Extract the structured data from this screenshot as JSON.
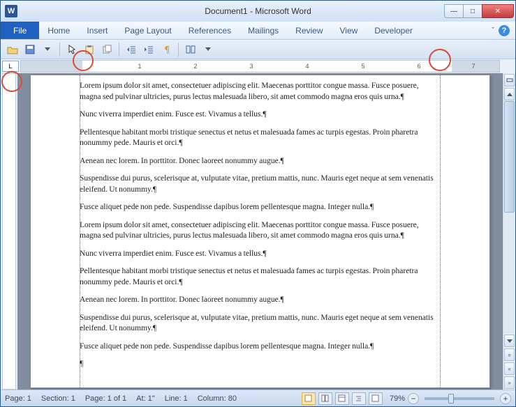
{
  "title": "Document1  -  Microsoft Word",
  "word_glyph": "W",
  "menu": {
    "file": "File",
    "items": [
      "Home",
      "Insert",
      "Page Layout",
      "References",
      "Mailings",
      "Review",
      "View",
      "Developer"
    ]
  },
  "ruler": {
    "ticks": [
      "1",
      "2",
      "3",
      "4",
      "5",
      "6",
      "7"
    ]
  },
  "corner_box": "L",
  "paragraphs": [
    "Lorem ipsum dolor sit amet, consectetuer adipiscing elit. Maecenas porttitor congue massa. Fusce posuere, magna sed pulvinar ultricies, purus lectus malesuada libero, sit amet commodo magna eros quis urna.¶",
    "Nunc viverra imperdiet enim. Fusce est. Vivamus a tellus.¶",
    "Pellentesque habitant morbi tristique senectus et netus et malesuada fames ac turpis egestas. Proin pharetra nonummy pede. Mauris et orci.¶",
    "Aenean nec lorem. In porttitor. Donec laoreet nonummy augue.¶",
    "Suspendisse dui purus, scelerisque at, vulputate vitae, pretium mattis, nunc. Mauris eget neque at sem venenatis eleifend. Ut nonummy.¶",
    "Fusce aliquet pede non pede. Suspendisse dapibus lorem pellentesque magna. Integer nulla.¶",
    "Lorem ipsum dolor sit amet, consectetuer adipiscing elit. Maecenas porttitor congue massa. Fusce posuere, magna sed pulvinar ultricies, purus lectus malesuada libero, sit amet commodo magna eros quis urna.¶",
    "Nunc viverra imperdiet enim. Fusce est. Vivamus a tellus.¶",
    "Pellentesque habitant morbi tristique senectus et netus et malesuada fames ac turpis egestas. Proin pharetra nonummy pede. Mauris et orci.¶",
    "Aenean nec lorem. In porttitor. Donec laoreet nonummy augue.¶",
    "Suspendisse dui purus, scelerisque at, vulputate vitae, pretium mattis, nunc. Mauris eget neque at sem venenatis eleifend. Ut nonummy.¶",
    "Fusce aliquet pede non pede. Suspendisse dapibus lorem pellentesque magna. Integer nulla.¶",
    "¶"
  ],
  "status": {
    "page": "Page: 1",
    "section": "Section: 1",
    "page_of": "Page: 1 of 1",
    "at": "At: 1\"",
    "line": "Line: 1",
    "column": "Column: 80",
    "zoom": "79%"
  },
  "icons": {
    "minimize": "—",
    "maximize": "□",
    "close": "✕",
    "help": "?",
    "caron": "ˇ",
    "plus": "+",
    "minus": "−"
  }
}
